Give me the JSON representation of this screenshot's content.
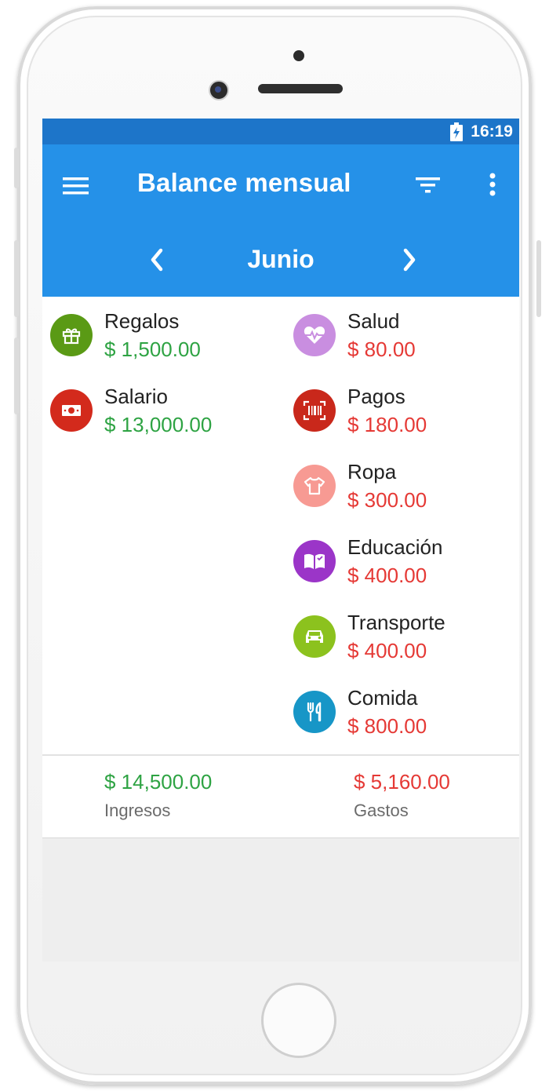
{
  "status": {
    "time": "16:19"
  },
  "appbar": {
    "title": "Balance mensual",
    "icons": [
      "menu-icon",
      "filter-icon",
      "more-vert-icon"
    ]
  },
  "month": {
    "label": "Junio",
    "icons": [
      "chevron-left-icon",
      "chevron-right-icon"
    ]
  },
  "income": [
    {
      "name": "Regalos",
      "amount": "$ 1,500.00",
      "icon": "gift-icon",
      "color": "#5a9a15"
    },
    {
      "name": "Salario",
      "amount": "$ 13,000.00",
      "icon": "banknote-icon",
      "color": "#d32a1c"
    }
  ],
  "expenses": [
    {
      "name": "Salud",
      "amount": "$ 80.00",
      "icon": "heart-pulse-icon",
      "color": "#c98ee0"
    },
    {
      "name": "Pagos",
      "amount": "$ 180.00",
      "icon": "barcode-icon",
      "color": "#c9281b"
    },
    {
      "name": "Ropa",
      "amount": "$ 300.00",
      "icon": "tshirt-icon",
      "color": "#f79a93"
    },
    {
      "name": "Educación",
      "amount": "$ 400.00",
      "icon": "book-icon",
      "color": "#9b35c8"
    },
    {
      "name": "Transporte",
      "amount": "$ 400.00",
      "icon": "car-icon",
      "color": "#8cc21e"
    },
    {
      "name": "Comida",
      "amount": "$ 800.00",
      "icon": "cutlery-icon",
      "color": "#1796c7"
    }
  ],
  "summary": {
    "income_total": "$ 14,500.00",
    "income_label": "Ingresos",
    "expense_total": "$ 5,160.00",
    "expense_label": "Gastos"
  },
  "colors": {
    "appbar": "#2591e8",
    "statusbar": "#1d75c9",
    "income": "#2ea343",
    "expense": "#e53935"
  }
}
